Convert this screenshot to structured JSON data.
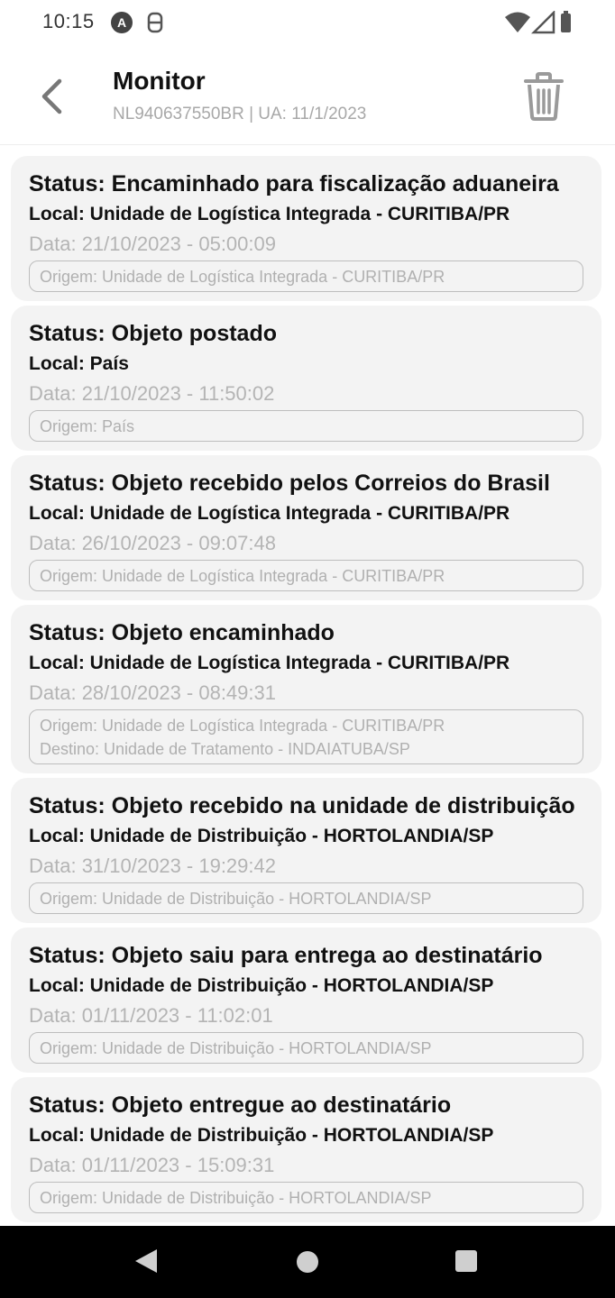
{
  "status_bar": {
    "time": "10:15",
    "icons": [
      "a-badge-icon",
      "sim-icon",
      "wifi-icon",
      "signal-icon",
      "battery-icon"
    ]
  },
  "header": {
    "title": "Monitor",
    "subtitle": "NL940637550BR | UA: 11/1/2023"
  },
  "events": [
    {
      "status": "Status: Encaminhado para fiscalização aduaneira",
      "local": "Local: Unidade de Logística Integrada - CURITIBA/PR",
      "data": "Data: 21/10/2023 - 05:00:09",
      "origem": "Origem: Unidade de Logística Integrada - CURITIBA/PR",
      "destino": ""
    },
    {
      "status": "Status: Objeto postado",
      "local": "Local: País",
      "data": "Data: 21/10/2023 - 11:50:02",
      "origem": "Origem: País",
      "destino": ""
    },
    {
      "status": "Status: Objeto recebido pelos Correios do Brasil",
      "local": "Local: Unidade de Logística Integrada - CURITIBA/PR",
      "data": "Data: 26/10/2023 - 09:07:48",
      "origem": "Origem: Unidade de Logística Integrada - CURITIBA/PR",
      "destino": ""
    },
    {
      "status": "Status: Objeto encaminhado",
      "local": "Local: Unidade de Logística Integrada - CURITIBA/PR",
      "data": "Data: 28/10/2023 - 08:49:31",
      "origem": "Origem: Unidade de Logística Integrada - CURITIBA/PR",
      "destino": "Destino: Unidade de Tratamento - INDAIATUBA/SP"
    },
    {
      "status": "Status: Objeto recebido na unidade de distribuição",
      "local": "Local: Unidade de Distribuição - HORTOLANDIA/SP",
      "data": "Data: 31/10/2023 - 19:29:42",
      "origem": "Origem: Unidade de Distribuição - HORTOLANDIA/SP",
      "destino": ""
    },
    {
      "status": "Status: Objeto saiu para entrega ao destinatário",
      "local": "Local: Unidade de Distribuição - HORTOLANDIA/SP",
      "data": "Data: 01/11/2023 - 11:02:01",
      "origem": "Origem: Unidade de Distribuição - HORTOLANDIA/SP",
      "destino": ""
    },
    {
      "status": "Status: Objeto entregue ao destinatário",
      "local": "Local: Unidade de Distribuição - HORTOLANDIA/SP",
      "data": "Data: 01/11/2023 - 15:09:31",
      "origem": "Origem: Unidade de Distribuição - HORTOLANDIA/SP",
      "destino": ""
    }
  ]
}
